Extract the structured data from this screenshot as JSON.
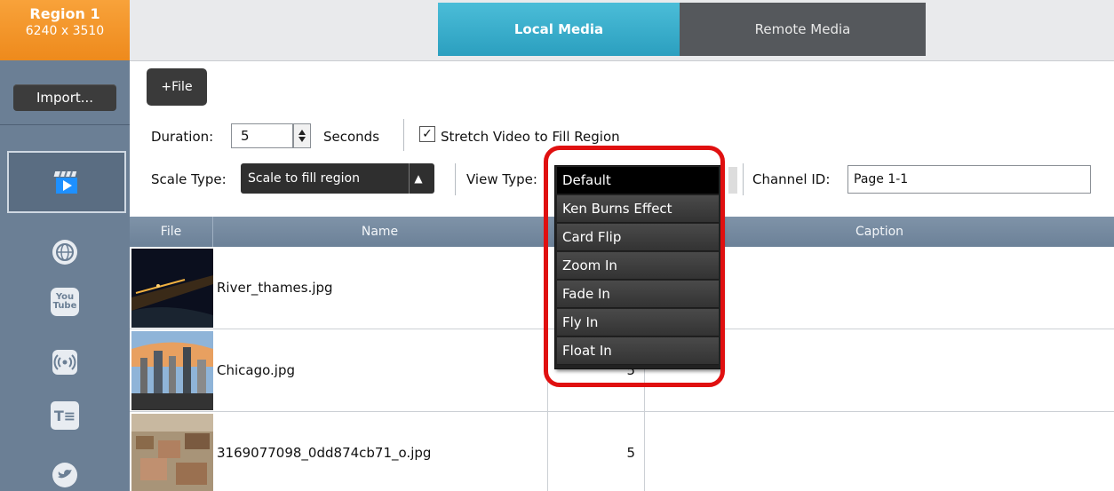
{
  "sidebar": {
    "region_title": "Region 1",
    "region_size": "6240 x 3510",
    "import_label": "Import...",
    "icons": [
      "clapboard-icon",
      "globe-icon",
      "youtube-icon",
      "broadcast-icon",
      "text-icon",
      "twitter-icon"
    ],
    "yt_top": "You",
    "yt_bottom": "Tube",
    "text_glyph": "T≡"
  },
  "tabs": {
    "local": "Local Media",
    "remote": "Remote Media"
  },
  "toolbar": {
    "add_file": "+File",
    "duration_label": "Duration:",
    "duration_value": "5",
    "seconds_label": "Seconds",
    "stretch_label": "Stretch Video to Fill Region",
    "stretch_checked": "✓",
    "scale_type_label": "Scale Type:",
    "scale_type_value": "Scale to fill region",
    "view_type_label": "View Type:",
    "channel_label": "Channel ID:",
    "channel_value": "Page 1-1"
  },
  "table": {
    "headers": {
      "file": "File",
      "name": "Name",
      "caption": "Caption"
    },
    "rows": [
      {
        "name": "River_thames.jpg",
        "duration": ""
      },
      {
        "name": "Chicago.jpg",
        "duration": "5"
      },
      {
        "name": "3169077098_0dd874cb71_o.jpg",
        "duration": "5"
      }
    ]
  },
  "dropdown": {
    "items": [
      "Default",
      "Ken Burns Effect",
      "Card Flip",
      "Zoom In",
      "Fade In",
      "Fly In",
      "Float In"
    ],
    "selected": "Default"
  },
  "colors": {
    "accent_orange": "#ee8a1c",
    "tab_active": "#2b9fbf",
    "sidebar": "#6b7f95",
    "highlight": "#e01010"
  }
}
